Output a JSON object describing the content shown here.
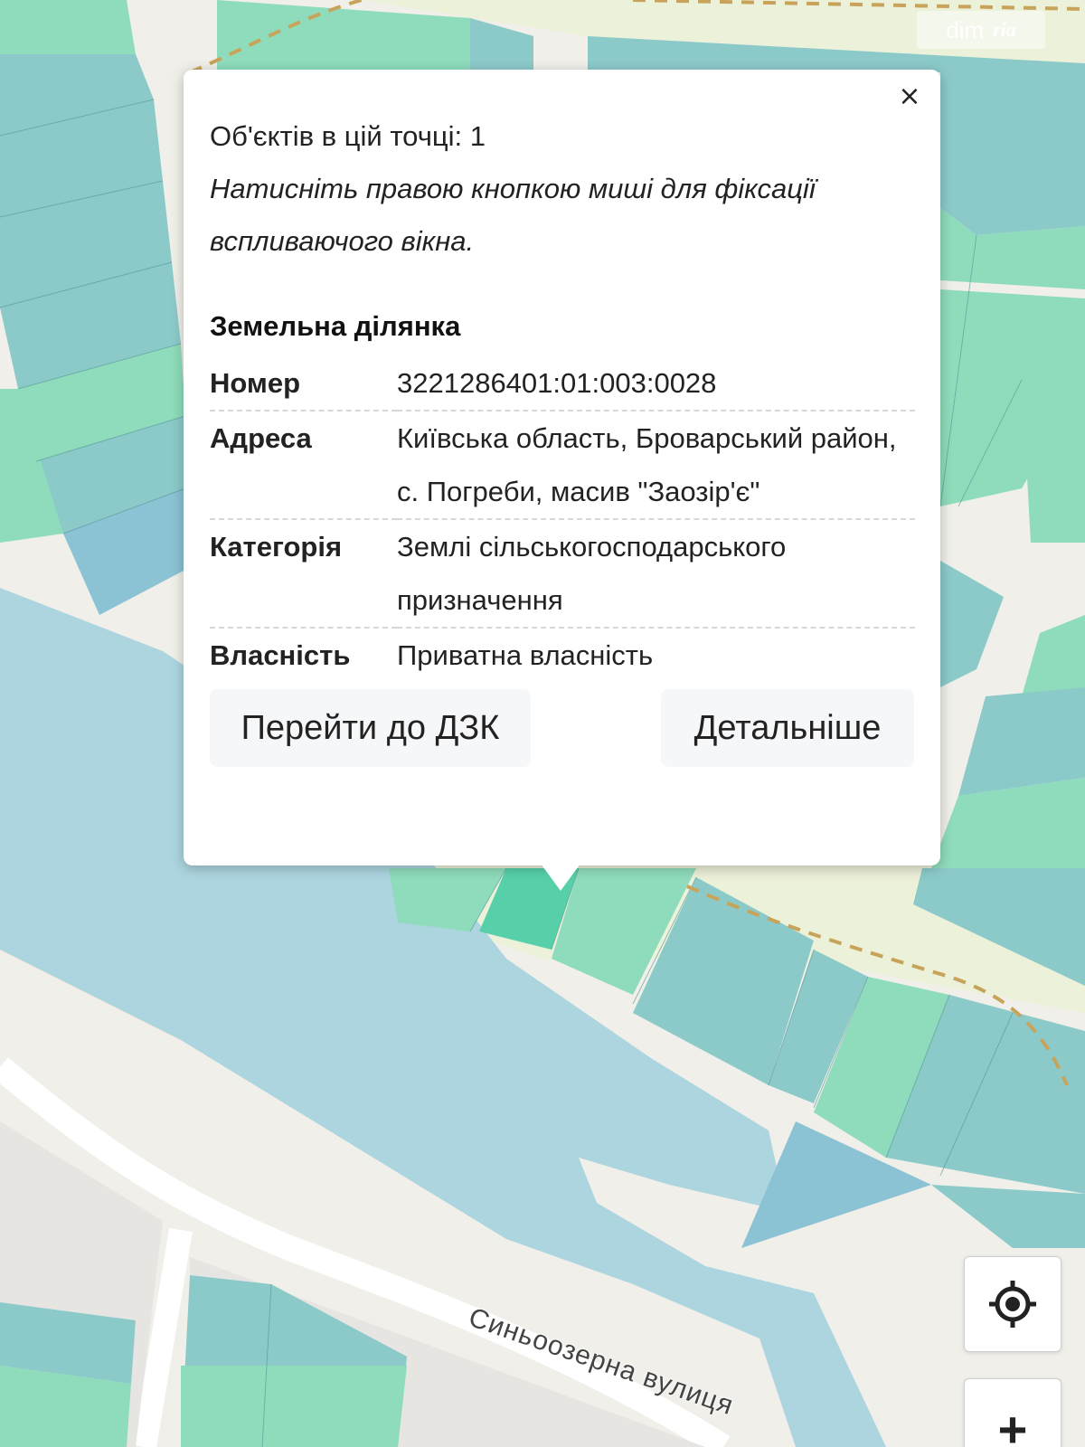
{
  "watermark": {
    "text_a": "dim",
    "text_b": "ria"
  },
  "popup": {
    "close_label": "×",
    "count_text": "Об'єктів в цій точці: 1",
    "hint_text": "Натисніть правою кнопкою миші для фіксації вспливаючого вікна.",
    "section_title": "Земельна ділянка",
    "rows": [
      {
        "key": "Номер",
        "value": "3221286401:01:003:0028"
      },
      {
        "key": "Адреса",
        "value": "Київська область, Броварський район, с. Погреби, масив \"Заозір'є\""
      },
      {
        "key": "Категорія",
        "value": "Землі сільськогосподарського призначення"
      },
      {
        "key": "Власність",
        "value": "Приватна власність"
      }
    ],
    "buttons": {
      "dzk_label": "Перейти до ДЗК",
      "details_label": "Детальніше"
    }
  },
  "map": {
    "street_label": "Синьоозерна вулиця",
    "colors": {
      "parcel_green": "#8fdcbc",
      "parcel_teal": "#8ccaca",
      "parcel_blue": "#8bc3d4",
      "selected_parcel": "#57d0a9",
      "water": "#add5e0",
      "background": "#f0efe9",
      "road": "#ffffff",
      "path": "#c8a35a"
    }
  },
  "controls": {
    "locate_icon": "crosshair-locate-icon",
    "zoom_in_label": "+"
  }
}
